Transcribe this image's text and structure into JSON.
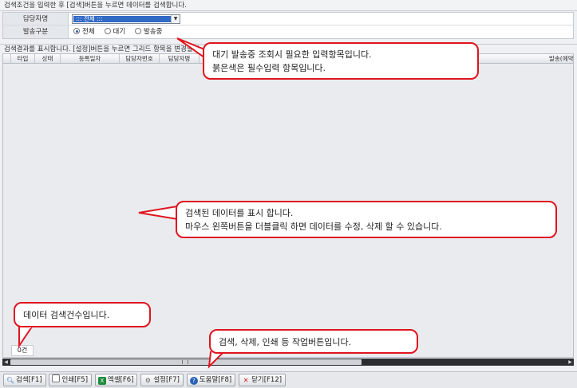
{
  "search_header": "검색조건을 입력한 후 [검색]버튼을 누르면 데이터를 검색합니다.",
  "form": {
    "manager_label": "담당자명",
    "manager_value": "::: 전체 :::",
    "send_label": "발송구분",
    "radios": [
      {
        "label": "전체",
        "checked": true
      },
      {
        "label": "대기",
        "checked": false
      },
      {
        "label": "발송중",
        "checked": false
      }
    ]
  },
  "result_header": "검색결과를 표시합니다. [설정]버튼을 누르면 그리드 항목을 변경할 수",
  "grid": {
    "columns": [
      "타입",
      "상태",
      "등록일자",
      "담당자번호",
      "담당자명",
      "발송(예약"
    ]
  },
  "count": "0건",
  "toolbar": {
    "search": "검색[F1]",
    "print": "인쇄[F5]",
    "excel": "엑셀[F6]",
    "settings": "설정[F7]",
    "help": "도움말[F8]",
    "close": "닫기[F12]"
  },
  "callouts": {
    "c1_line1": "대기 발송중 조회시 필요한 입력항목입니다.",
    "c1_line2": "붉은색은 필수입력 항목입니다.",
    "c2_line1": "검색된 데이터를 표시 합니다.",
    "c2_line2": "마우스 왼쪽버튼을 더블클릭 하면 데이터를 수정, 삭제 할 수 있습니다.",
    "c3": "데이터 검색건수입니다.",
    "c4": "검색, 삭제,  인쇄   등 작업버튼입니다."
  },
  "colors": {
    "callout_border": "#e0141e",
    "select_highlight": "#316ac5"
  }
}
